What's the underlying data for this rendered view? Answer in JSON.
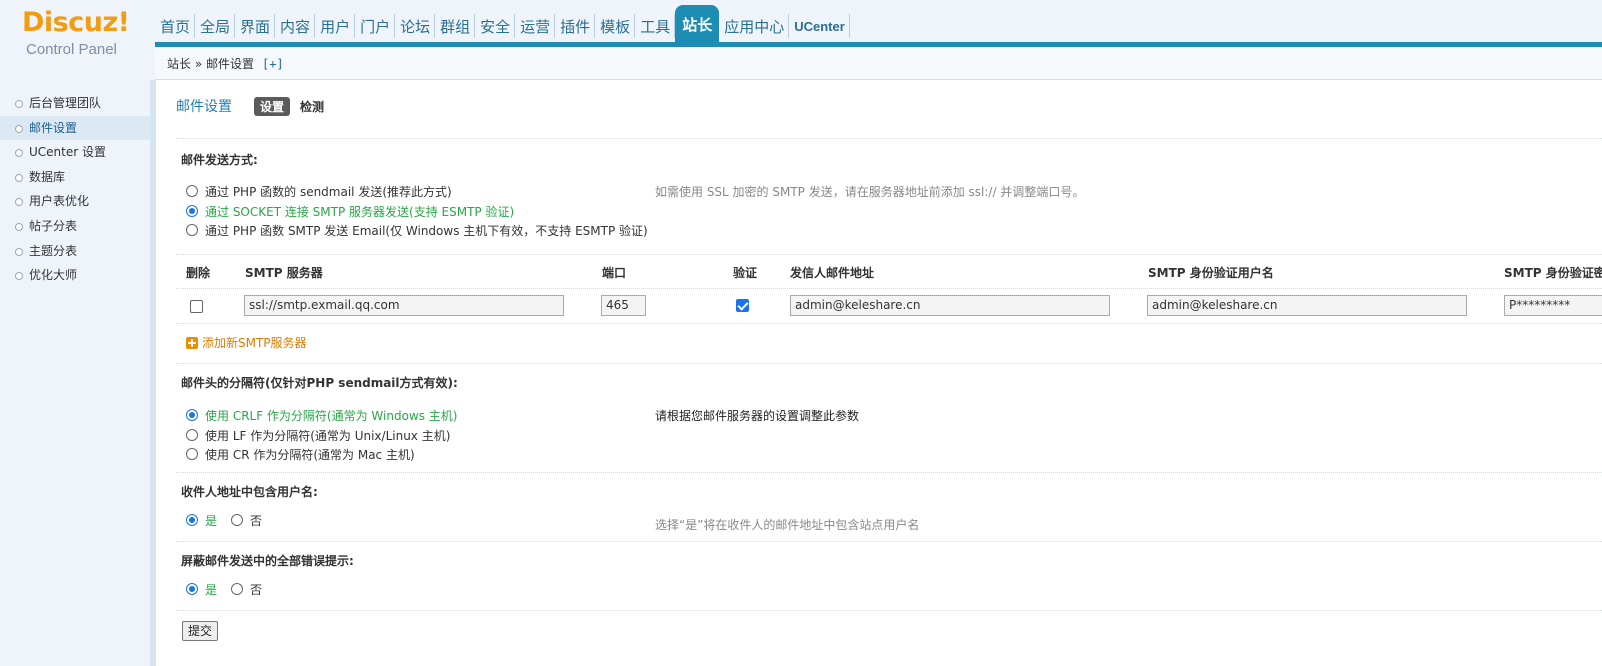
{
  "logo": {
    "brand": "Discuz!",
    "sub": "Control Panel"
  },
  "nav": {
    "items": [
      "首页",
      "全局",
      "界面",
      "内容",
      "用户",
      "门户",
      "论坛",
      "群组",
      "安全",
      "运营",
      "插件",
      "模板",
      "工具",
      "站长",
      "应用中心",
      "UCenter"
    ],
    "active": "站长"
  },
  "breadcrumb": {
    "text": "站长 » 邮件设置",
    "toggle": "[+]"
  },
  "sidebar": {
    "items": [
      "后台管理团队",
      "邮件设置",
      "UCenter 设置",
      "数据库",
      "用户表优化",
      "帖子分表",
      "主题分表",
      "优化大师"
    ],
    "active": "邮件设置"
  },
  "page": {
    "title": "邮件设置",
    "tab_active": "设置",
    "tab_other": "检测"
  },
  "mail_method": {
    "label": "邮件发送方式:",
    "options": [
      "通过 PHP 函数的 sendmail 发送(推荐此方式)",
      "通过 SOCKET 连接 SMTP 服务器发送(支持 ESMTP 验证)",
      "通过 PHP 函数 SMTP 发送 Email(仅 Windows 主机下有效，不支持 ESMTP 验证)"
    ],
    "selected_index": 1,
    "hint": "如需使用 SSL 加密的 SMTP 发送，请在服务器地址前添加 ssl:// 并调整端口号。"
  },
  "smtp_table": {
    "headers": [
      "删除",
      "SMTP 服务器",
      "端口",
      "验证",
      "发信人邮件地址",
      "SMTP 身份验证用户名",
      "SMTP 身份验证密码"
    ],
    "rows": [
      {
        "delete": false,
        "server": "ssl://smtp.exmail.qq.com",
        "port": "465",
        "auth": true,
        "from": "admin@keleshare.cn",
        "username": "admin@keleshare.cn",
        "password": "P*********"
      }
    ],
    "add_label": "添加新SMTP服务器"
  },
  "mail_delimiter": {
    "label": "邮件头的分隔符(仅针对PHP sendmail方式有效):",
    "options": [
      "使用 CRLF 作为分隔符(通常为 Windows 主机)",
      "使用 LF 作为分隔符(通常为 Unix/Linux 主机)",
      "使用 CR 作为分隔符(通常为 Mac 主机)"
    ],
    "selected_index": 0,
    "hint": "请根据您邮件服务器的设置调整此参数"
  },
  "include_username": {
    "label": "收件人地址中包含用户名:",
    "yes": "是",
    "no": "否",
    "value": "yes",
    "hint": "选择“是”将在收件人的邮件地址中包含站点用户名"
  },
  "silent_errors": {
    "label": "屏蔽邮件发送中的全部错误提示:",
    "yes": "是",
    "no": "否",
    "value": "yes"
  },
  "submit_label": "提交",
  "colors": {
    "accent": "#1e8db4",
    "selected_green": "#28a745",
    "link_orange": "#e07b00"
  }
}
